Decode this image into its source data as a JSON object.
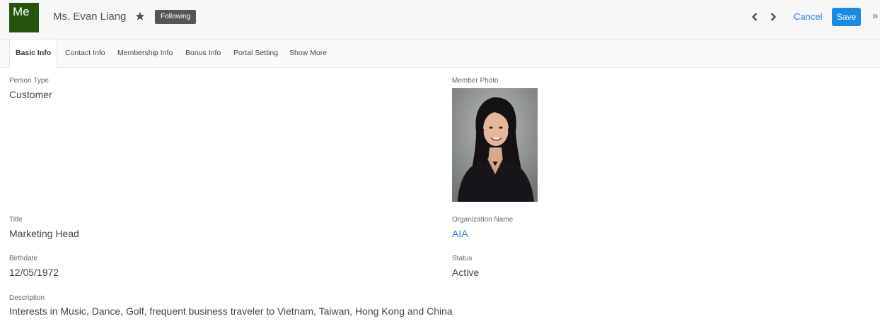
{
  "header": {
    "avatar_text": "Me",
    "avatar_color": "#23530c",
    "name": "Ms. Evan Liang",
    "follow_label": "Following",
    "cancel_label": "Cancel",
    "save_label": "Save",
    "more_glyph": "»"
  },
  "tabs": [
    {
      "label": "Basic Info",
      "active": true
    },
    {
      "label": "Contact Info",
      "active": false
    },
    {
      "label": "Membership Info",
      "active": false
    },
    {
      "label": "Bonus Info",
      "active": false
    },
    {
      "label": "Portal Setting",
      "active": false
    },
    {
      "label": "Show More",
      "active": false
    }
  ],
  "fields": {
    "person_type": {
      "label": "Person Type",
      "value": "Customer"
    },
    "member_photo": {
      "label": "Member Photo"
    },
    "title": {
      "label": "Title",
      "value": "Marketing Head"
    },
    "organization": {
      "label": "Organization Name",
      "value": "AIA"
    },
    "birthdate": {
      "label": "Birthdate",
      "value": "12/05/1972"
    },
    "status": {
      "label": "Status",
      "value": "Active"
    },
    "description": {
      "label": "Description",
      "value": "Interests in Music, Dance, Golf, frequent business traveler to Vietnam, Taiwan, Hong Kong and China"
    }
  },
  "colors": {
    "accent": "#1e88e5",
    "link": "#2a7fd6"
  }
}
